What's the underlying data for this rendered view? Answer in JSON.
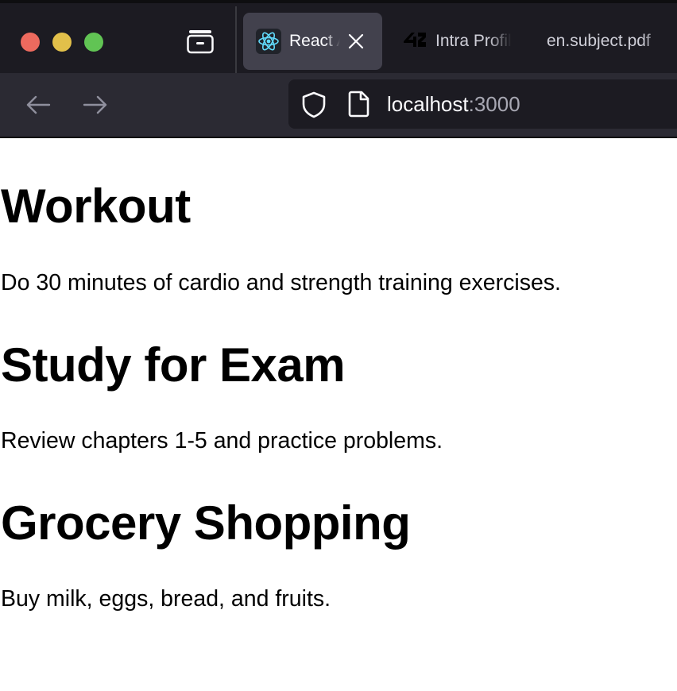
{
  "browser": {
    "tabs": [
      {
        "title": "React App",
        "active": true,
        "favicon": "react-atom-icon"
      },
      {
        "title": "Intra Profile",
        "active": false,
        "favicon": "42-logo-icon"
      },
      {
        "title": "en.subject.pdf",
        "active": false,
        "favicon": null
      }
    ],
    "url": {
      "host": "localhost",
      "port": ":3000"
    },
    "colors": {
      "red": "#ed6a5e",
      "yellow": "#e2c04a",
      "green": "#61c454",
      "react": "#61dafb"
    }
  },
  "page": {
    "items": [
      {
        "title": "Workout",
        "description": "Do 30 minutes of cardio and strength training exercises."
      },
      {
        "title": "Study for Exam",
        "description": "Review chapters 1-5 and practice problems."
      },
      {
        "title": "Grocery Shopping",
        "description": "Buy milk, eggs, bread, and fruits."
      }
    ]
  }
}
